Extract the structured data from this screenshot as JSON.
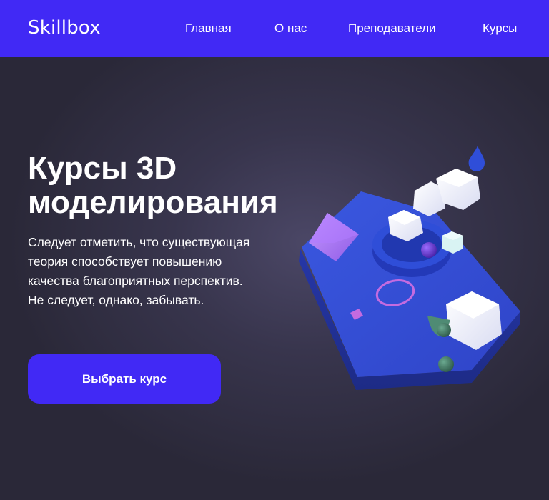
{
  "header": {
    "logo": "Skillbox",
    "nav": [
      {
        "label": "Главная"
      },
      {
        "label": "О нас"
      },
      {
        "label": "Преподаватели"
      },
      {
        "label": "Курсы"
      }
    ]
  },
  "hero": {
    "title_line1": "Курсы 3D",
    "title_line2": "моделирования",
    "description": [
      "Следует отметить, что существующая",
      "теория способствует повышению",
      "качества благоприятных перспектив.",
      "Не следует, однако, забывать."
    ],
    "cta_label": "Выбрать курс"
  },
  "colors": {
    "brand": "#4129f5",
    "background": "#2a2838",
    "text": "#ffffff"
  }
}
